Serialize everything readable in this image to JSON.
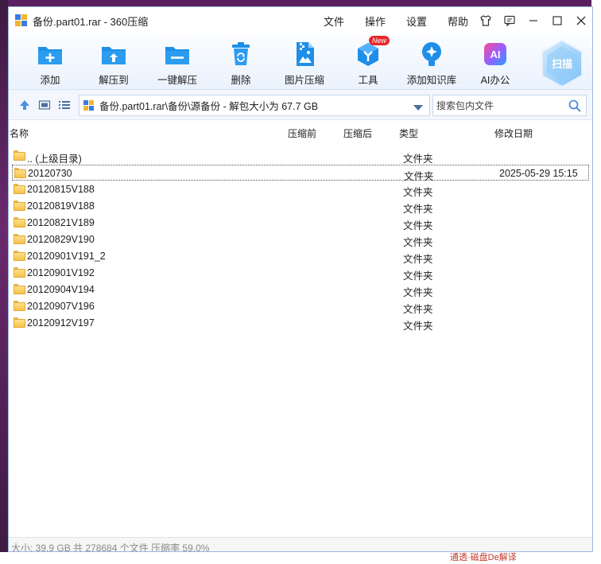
{
  "window": {
    "title": "备份.part01.rar - 360压缩"
  },
  "menu": [
    "文件",
    "操作",
    "设置",
    "帮助"
  ],
  "toolbar": {
    "items": [
      {
        "label": "添加",
        "icon": "add-folder-icon"
      },
      {
        "label": "解压到",
        "icon": "extract-folder-icon"
      },
      {
        "label": "一键解压",
        "icon": "one-click-extract-icon"
      },
      {
        "label": "删除",
        "icon": "recycle-bin-icon"
      },
      {
        "label": "图片压缩",
        "icon": "image-compress-icon"
      },
      {
        "label": "工具",
        "icon": "tools-cube-icon",
        "badge": "New"
      },
      {
        "label": "添加知识库",
        "icon": "knowledge-bulb-icon"
      },
      {
        "label": "AI办公",
        "icon": "ai-office-icon",
        "icon_text": "AI"
      }
    ],
    "scan_label": "扫描"
  },
  "address": {
    "path": "备份.part01.rar\\备份\\源备份 - 解包大小为 67.7 GB",
    "search_placeholder": "搜索包内文件"
  },
  "columns": {
    "name": "名称",
    "before": "压缩前",
    "after": "压缩后",
    "type": "类型",
    "modified": "修改日期"
  },
  "files": [
    {
      "name": ".. (上级目录)",
      "type": "文件夹",
      "date": ""
    },
    {
      "name": "20120730",
      "type": "文件夹",
      "date": "2025-05-29 15:15",
      "selected": true
    },
    {
      "name": "20120815V188",
      "type": "文件夹",
      "date": ""
    },
    {
      "name": "20120819V188",
      "type": "文件夹",
      "date": ""
    },
    {
      "name": "20120821V189",
      "type": "文件夹",
      "date": ""
    },
    {
      "name": "20120829V190",
      "type": "文件夹",
      "date": ""
    },
    {
      "name": "20120901V191_2",
      "type": "文件夹",
      "date": ""
    },
    {
      "name": "20120901V192",
      "type": "文件夹",
      "date": ""
    },
    {
      "name": "20120904V194",
      "type": "文件夹",
      "date": ""
    },
    {
      "name": "20120907V196",
      "type": "文件夹",
      "date": ""
    },
    {
      "name": "20120912V197",
      "type": "文件夹",
      "date": ""
    }
  ],
  "status": {
    "text": "大小: 39.9 GB 共 278684 个文件 压缩率 59.0%"
  },
  "background": {
    "snippet": "通透·磁盘De解译"
  },
  "colors": {
    "accent": "#1e8fe8",
    "selection_border": "#555555",
    "folder": "#f5c24c"
  }
}
